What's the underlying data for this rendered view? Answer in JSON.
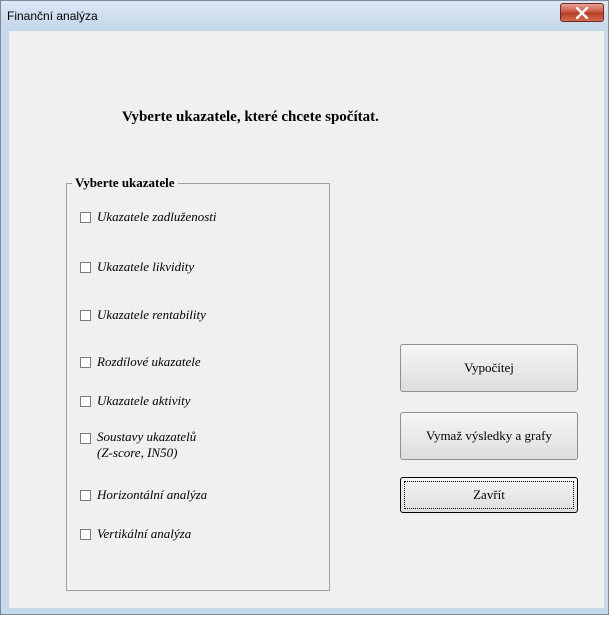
{
  "window": {
    "title": "Finanční analýza",
    "close_icon": "close-x-icon"
  },
  "dialog": {
    "heading": "Vyberte ukazatele, které chcete spočítat."
  },
  "indicators_group": {
    "legend": "Vyberte ukazatele",
    "items": [
      {
        "label": "Ukazatele zadluženosti",
        "checked": false
      },
      {
        "label": "Ukazatele likvidity",
        "checked": false
      },
      {
        "label": "Ukazatele rentability",
        "checked": false
      },
      {
        "label": "Rozdílové ukazatele",
        "checked": false
      },
      {
        "label": "Ukazatele aktivity",
        "checked": false
      },
      {
        "label": "Soustavy ukazatelů",
        "label_line2": "(Z-score, IN50)",
        "checked": false
      },
      {
        "label": "Horizontální analýza",
        "checked": false
      },
      {
        "label": "Vertikální analýza",
        "checked": false
      }
    ]
  },
  "buttons": {
    "calculate": "Vypočítej",
    "clear": "Vymaž výsledky a grafy",
    "close": "Zavřít"
  },
  "colors": {
    "titlebar": "#c9d9ec",
    "client_background": "#f0f0f0",
    "close_button": "#c9503b"
  }
}
